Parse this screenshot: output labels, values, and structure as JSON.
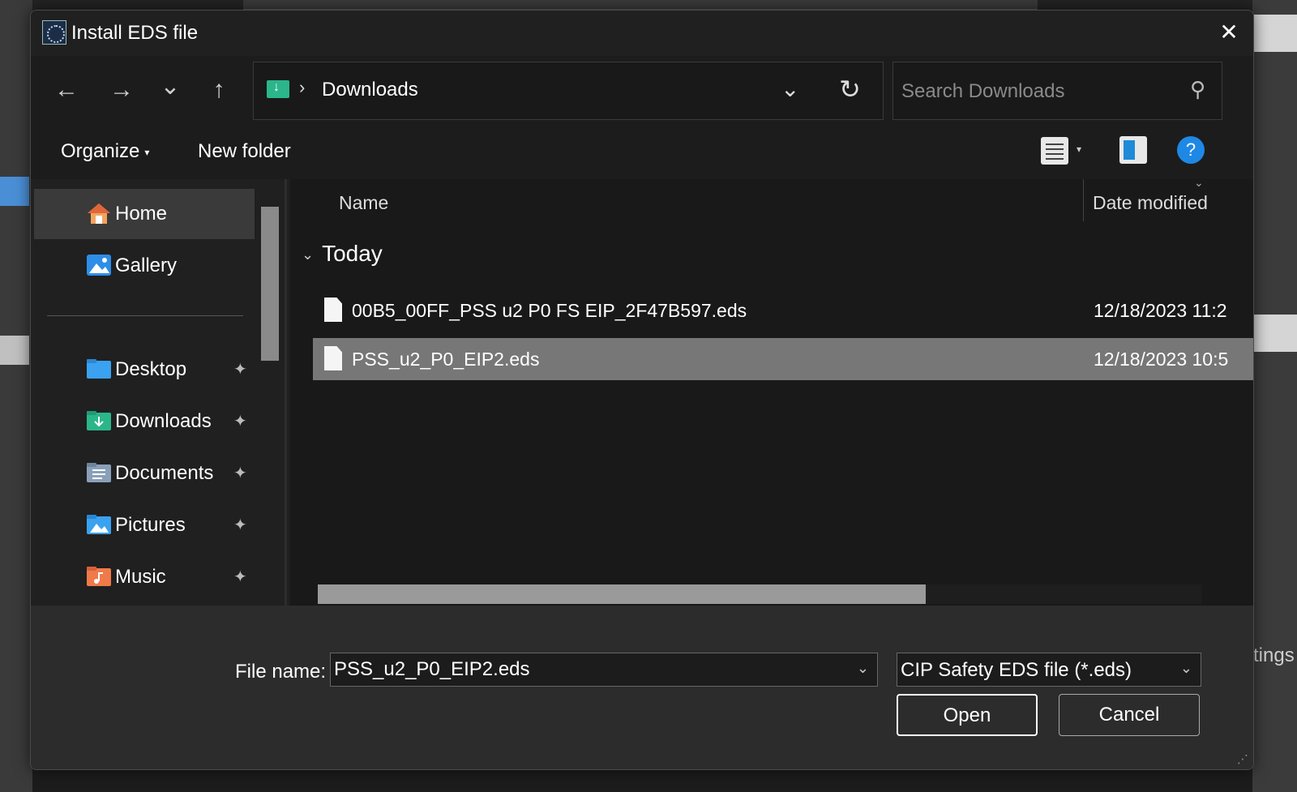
{
  "background": {
    "right_fragment_text": "tings"
  },
  "dialog": {
    "title": "Install EDS file",
    "close_glyph": "✕"
  },
  "nav": {
    "back_glyph": "←",
    "forward_glyph": "→",
    "recent_glyph": "⌄",
    "up_glyph": "↑",
    "address_chevron": "›",
    "address_location": "Downloads",
    "address_dropdown_glyph": "⌄",
    "refresh_glyph": "↻",
    "search_placeholder": "Search Downloads",
    "search_glyph": "⚲"
  },
  "toolbar": {
    "organize_label": "Organize",
    "new_folder_label": "New folder",
    "help_glyph": "?"
  },
  "sidebar": {
    "items": [
      {
        "label": "Home",
        "icon": "home-icon",
        "active": true,
        "pinned": false
      },
      {
        "label": "Gallery",
        "icon": "gallery-icon",
        "active": false,
        "pinned": false
      },
      {
        "label": "Desktop",
        "icon": "desktop-folder-icon",
        "active": false,
        "pinned": true
      },
      {
        "label": "Downloads",
        "icon": "downloads-folder-icon",
        "active": false,
        "pinned": true
      },
      {
        "label": "Documents",
        "icon": "documents-folder-icon",
        "active": false,
        "pinned": true
      },
      {
        "label": "Pictures",
        "icon": "pictures-folder-icon",
        "active": false,
        "pinned": true
      },
      {
        "label": "Music",
        "icon": "music-folder-icon",
        "active": false,
        "pinned": true
      }
    ],
    "pin_glyph": "📌"
  },
  "files": {
    "columns": {
      "name": "Name",
      "date": "Date modified"
    },
    "group_label": "Today",
    "rows": [
      {
        "name": "00B5_00FF_PSS u2 P0 FS EIP_2F47B597.eds",
        "date": "12/18/2023 11:2",
        "selected": false
      },
      {
        "name": "PSS_u2_P0_EIP2.eds",
        "date": "12/18/2023 10:5",
        "selected": true
      }
    ]
  },
  "footer": {
    "file_name_label": "File name:",
    "file_name_value": "PSS_u2_P0_EIP2.eds",
    "file_type_value": "CIP Safety EDS file (*.eds)",
    "open_label": "Open",
    "cancel_label": "Cancel"
  },
  "colors": {
    "accent": "#1e88e5",
    "downloads_folder": "#2bb58a",
    "selected_row": "#777777"
  }
}
